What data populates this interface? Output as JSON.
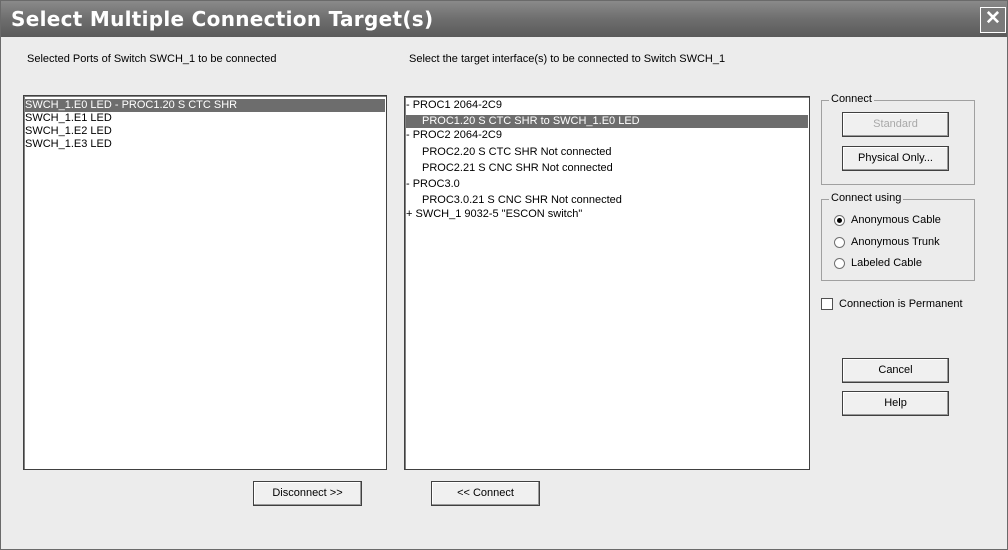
{
  "window": {
    "title": "Select Multiple Connection Target(s)",
    "close_glyph": "✕"
  },
  "left": {
    "label": "Selected Ports of Switch SWCH_1 to be connected",
    "items": [
      "SWCH_1.E0 LED  -  PROC1.20 S CTC SHR",
      "SWCH_1.E1 LED",
      "SWCH_1.E2 LED",
      "SWCH_1.E3 LED"
    ],
    "selected_index": 0
  },
  "middle": {
    "label": "Select the target interface(s) to be connected to Switch SWCH_1",
    "items": [
      "- PROC1 2064-2C9",
      "PROC1.20 S CTC SHR to SWCH_1.E0 LED",
      "- PROC2 2064-2C9",
      "PROC2.20 S CTC SHR Not connected",
      "PROC2.21 S CNC SHR Not connected",
      "- PROC3.0",
      "PROC3.0.21 S CNC SHR Not connected",
      "+ SWCH_1 9032-5 \"ESCON switch\""
    ],
    "selected_index": 1
  },
  "connect_group": {
    "title": "Connect",
    "standard_label": "Standard",
    "physical_only_label": "Physical Only..."
  },
  "connect_using": {
    "title": "Connect using",
    "options": [
      "Anonymous Cable",
      "Anonymous Trunk",
      "Labeled Cable"
    ],
    "selected": "Anonymous Cable"
  },
  "permanent": {
    "label": "Connection is Permanent",
    "checked": false
  },
  "buttons": {
    "cancel": "Cancel",
    "help": "Help",
    "disconnect": "Disconnect >>",
    "connect": "<< Connect"
  }
}
